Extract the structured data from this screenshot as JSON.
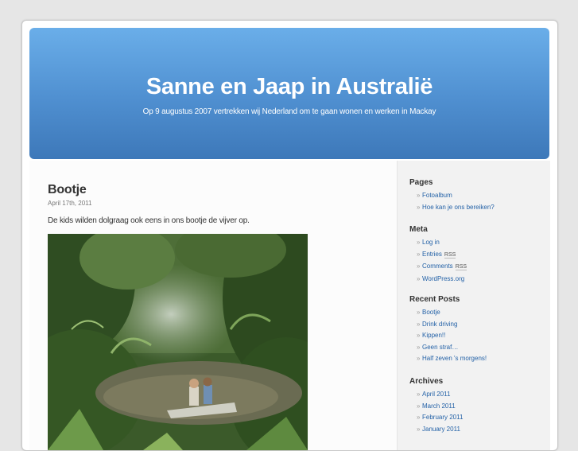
{
  "header": {
    "title": "Sanne en Jaap in Australië",
    "description": "Op 9 augustus 2007 vertrekken wij Nederland om te gaan wonen en werken in Mackay"
  },
  "post": {
    "title": "Bootje",
    "date": "April 17th, 2011",
    "text": "De kids wilden dolgraag ook eens in ons bootje de vijver op.",
    "image_icon": "boat-photo"
  },
  "sidebar": {
    "pages": {
      "heading": "Pages",
      "items": [
        "Fotoalbum",
        "Hoe kan je ons bereiken?"
      ]
    },
    "meta": {
      "heading": "Meta",
      "items": [
        {
          "label": "Log in",
          "badge": ""
        },
        {
          "label": "Entries",
          "badge": "RSS"
        },
        {
          "label": "Comments",
          "badge": "RSS"
        },
        {
          "label": "WordPress.org",
          "badge": ""
        }
      ]
    },
    "recent_posts": {
      "heading": "Recent Posts",
      "items": [
        "Bootje",
        "Drink driving",
        "Kippen!!",
        "Geen straf…",
        "Half zeven 's morgens!"
      ]
    },
    "archives": {
      "heading": "Archives",
      "items": [
        "April 2011",
        "March 2011",
        "February 2011",
        "January 2011"
      ]
    }
  },
  "colors": {
    "header_top": "#6aaee9",
    "header_bottom": "#3d78b9",
    "link": "#2462a7"
  }
}
